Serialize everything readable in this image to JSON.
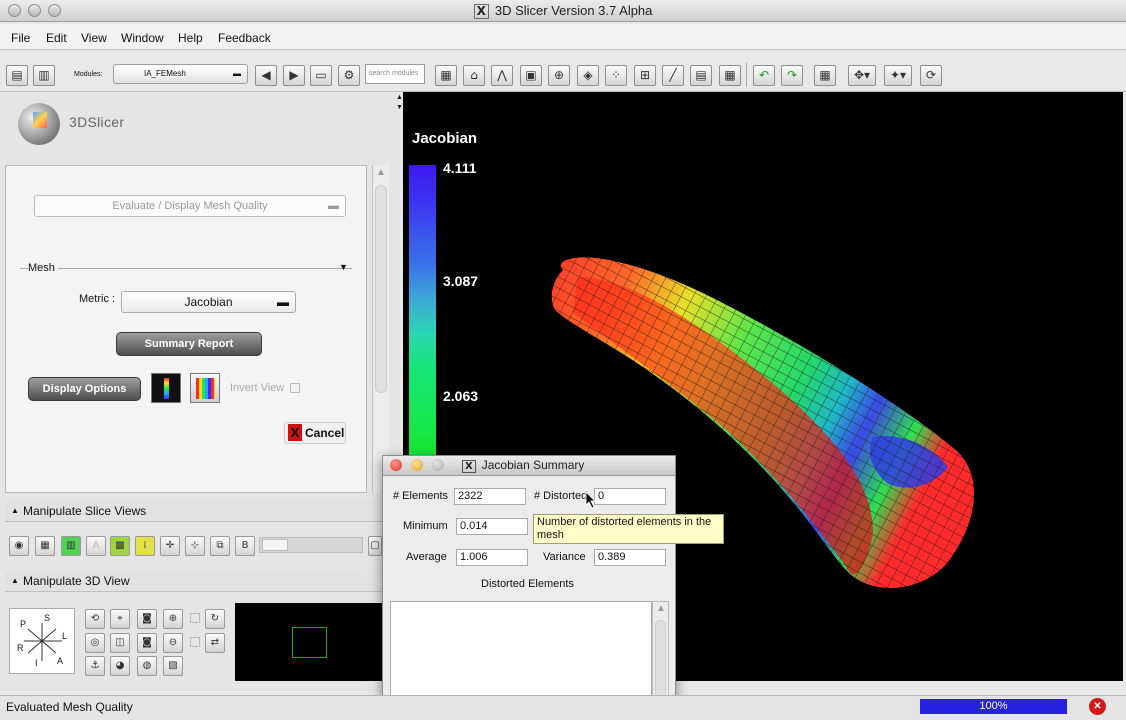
{
  "window": {
    "title": "3D Slicer Version 3.7 Alpha",
    "x_logo": "X"
  },
  "menu": [
    "File",
    "Edit",
    "View",
    "Window",
    "Help",
    "Feedback"
  ],
  "toolbar": {
    "modules_label": "Modules:",
    "module_selected": "IA_FEMesh",
    "search_placeholder": "search modules"
  },
  "logo": {
    "text": "3DSlicer"
  },
  "module_panel": {
    "eval_select": "Evaluate / Display Mesh Quality",
    "mesh_frame_label": "Mesh",
    "metric_label": "Metric :",
    "metric_value": "Jacobian",
    "summary_button": "Summary Report",
    "display_options_button": "Display Options",
    "invert_view_label": "Invert View",
    "cancel_button": "Cancel"
  },
  "sections": {
    "slice_views": "Manipulate Slice Views",
    "view_3d": "Manipulate 3D View"
  },
  "orientation": {
    "S": "S",
    "P": "P",
    "L": "L",
    "R": "R",
    "I": "I",
    "A": "A"
  },
  "colorbar": {
    "title": "Jacobian",
    "labels": [
      "4.111",
      "3.087",
      "2.063"
    ]
  },
  "dialog": {
    "title": "Jacobian Summary",
    "elements_label": "# Elements",
    "elements_value": "2322",
    "distorted_label": "# Distorted",
    "distorted_value": "0",
    "minimum_label": "Minimum",
    "minimum_value": "0.014",
    "average_label": "Average",
    "average_value": "1.006",
    "variance_label": "Variance",
    "variance_value": "0.389",
    "distorted_elements_label": "Distorted Elements",
    "tooltip": "Number of distorted elements in the mesh"
  },
  "status": {
    "text": "Evaluated Mesh Quality",
    "progress": "100%",
    "progress_value": 1.0
  },
  "colors": {
    "progress": "#2620e0",
    "accent_red": "#d21a1a",
    "viewer_bg": "#000000"
  }
}
